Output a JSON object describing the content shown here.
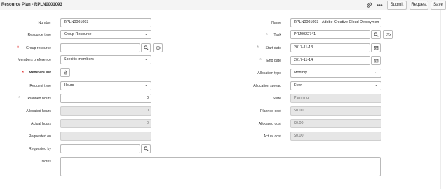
{
  "header": {
    "title": "Resource Plan - RPLN0001093",
    "buttons": {
      "submit": "Submit",
      "request": "Request",
      "save": "Save"
    },
    "icons": {
      "attachment": "paperclip-icon",
      "more": "more-options-icon"
    }
  },
  "form": {
    "number": {
      "label": "Number",
      "value": "RPLN0001093"
    },
    "name": {
      "label": "Name",
      "value": "RPLN0001093 - Adobe Creative Cloud Deploymen"
    },
    "resource_type": {
      "label": "Resource type",
      "value": "Group Resource"
    },
    "task": {
      "label": "Task",
      "value": "PRJ0022741"
    },
    "group_resource": {
      "label": "Group resource",
      "value": ""
    },
    "start_date": {
      "label": "Start date",
      "value": "2017-11-13"
    },
    "members_preference": {
      "label": "Members preference",
      "value": "Specific members"
    },
    "end_date": {
      "label": "End date",
      "value": "2017-11-14"
    },
    "members_list": {
      "label": "Members list"
    },
    "allocation_type": {
      "label": "Allocation type",
      "value": "Monthly"
    },
    "request_type": {
      "label": "Request type",
      "value": "Hours"
    },
    "allocation_spread": {
      "label": "Allocation spread",
      "value": "Even"
    },
    "planned_hours": {
      "label": "Planned hours",
      "value": "0"
    },
    "state": {
      "label": "State",
      "value": "Planning"
    },
    "allocated_hours": {
      "label": "Allocated hours",
      "value": "0"
    },
    "planned_cost": {
      "label": "Planned cost",
      "value": "$0.00"
    },
    "actual_hours": {
      "label": "Actual hours",
      "value": "0"
    },
    "allocated_cost": {
      "label": "Allocated cost",
      "value": "$0.00"
    },
    "requested_on": {
      "label": "Requested on",
      "value": ""
    },
    "actual_cost": {
      "label": "Actual cost",
      "value": "$0.00"
    },
    "requested_by": {
      "label": "Requested by",
      "value": ""
    },
    "notes": {
      "label": "Notes",
      "value": ""
    }
  },
  "colors": {
    "mandatory": "#e02828",
    "readonly_bg": "#e6e6e6",
    "header_bg": "#f4f4f4"
  }
}
